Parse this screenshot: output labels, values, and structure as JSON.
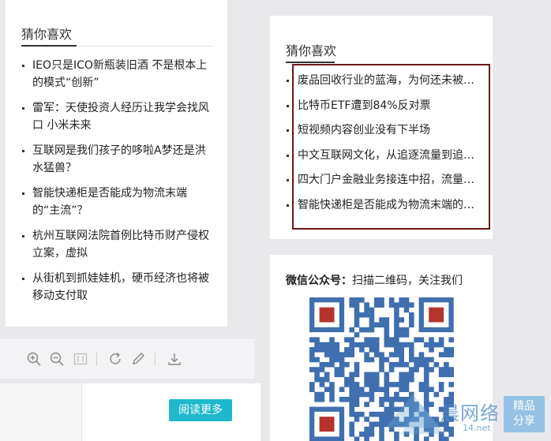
{
  "left_panel": {
    "title": "猜你喜欢",
    "items": [
      {
        "label": "IEO只是ICO新瓶装旧酒 不是根本上的模式“创新”"
      },
      {
        "label": "雷军：天使投资人经历让我学会找风口 小米未来"
      },
      {
        "label": "互联网是我们孩子的哆啦A梦还是洪水猛兽？"
      },
      {
        "label": "智能快递柜是否能成为物流末端的“主流”？"
      },
      {
        "label": "杭州互联网法院首例比特币财产侵权立案，虚拟"
      },
      {
        "label": "从街机到抓娃娃机，硬币经济也将被移动支付取"
      }
    ]
  },
  "toolbar": {
    "icons": [
      "zoom-in-icon",
      "zoom-out-icon",
      "fit-page-icon",
      "rotate-icon",
      "pen-icon",
      "download-icon"
    ]
  },
  "doc": {
    "read_more_label": "阅读更多"
  },
  "right_panel": {
    "title": "猜你喜欢",
    "items": [
      {
        "label": "废品回收行业的蓝海，为何还未被开发"
      },
      {
        "label": "比特币ETF遭到84%反对票"
      },
      {
        "label": "短视频内容创业没有下半场"
      },
      {
        "label": "中文互联网文化，从追逐流量到追逐价值"
      },
      {
        "label": "四大门户金融业务接连中招，流量模式"
      },
      {
        "label": "智能快递柜是否能成为物流末端的主流"
      }
    ],
    "highlight_color": "#6b1517"
  },
  "wechat": {
    "label": "微信公众号：",
    "text": "扫描二维码，关注我们"
  },
  "watermark": {
    "text": "晨网络",
    "sub": "14.net",
    "badge_line1": "精品",
    "badge_line2": "分享"
  },
  "colors": {
    "accent": "#20b8cc",
    "background": "#e9e9ec"
  }
}
